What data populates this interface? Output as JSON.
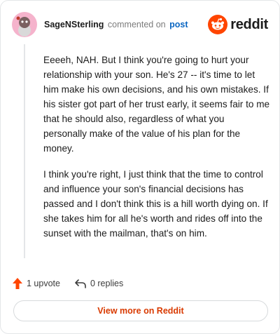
{
  "header": {
    "username": "SageNSterling",
    "action_text": "commented on",
    "post_link": "post",
    "logo_text": "reddit"
  },
  "comment": {
    "paragraphs": [
      "Eeeeh, NAH. But I think you're going to hurt your relationship with your son. He's 27 -- it's time to let him make his own decisions, and his own mistakes. If his sister got part of her trust early, it seems fair to me that he should also, regardless of what you personally make of the value of his plan for the money.",
      "I think you're right, I just think that the time to control and influence your son's financial decisions has passed and I don't think this is a hill worth dying on. If she takes him for all he's worth and rides off into the sunset with the mailman, that's on him."
    ]
  },
  "actions": {
    "upvote_label": "1 upvote",
    "replies_label": "0 replies"
  },
  "footer": {
    "view_more_label": "View more on Reddit"
  },
  "colors": {
    "accent": "#ff4500",
    "link": "#0a66c2",
    "view_more": "#d93a00"
  },
  "icons": {
    "avatar": "snoo-avatar-icon",
    "logo": "reddit-logo-icon",
    "upvote": "upvote-arrow-icon",
    "reply": "reply-arrow-icon"
  }
}
